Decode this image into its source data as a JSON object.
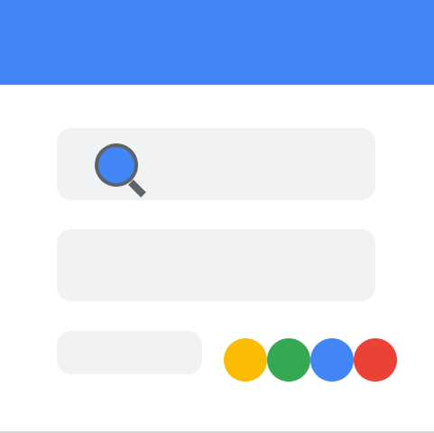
{
  "colors": {
    "accent_blue": "#4285f4",
    "field_background": "#f1f2f4",
    "icon_gray": "#5f6368",
    "google_yellow": "#fbbc04",
    "google_green": "#34a853",
    "google_blue": "#4285f4",
    "google_red": "#ea4335"
  },
  "icons": {
    "search": "search-icon"
  },
  "dots": [
    {
      "name": "yellow",
      "color": "#fbbc04"
    },
    {
      "name": "green",
      "color": "#34a853"
    },
    {
      "name": "blue",
      "color": "#4285f4"
    },
    {
      "name": "red",
      "color": "#ea4335"
    }
  ]
}
